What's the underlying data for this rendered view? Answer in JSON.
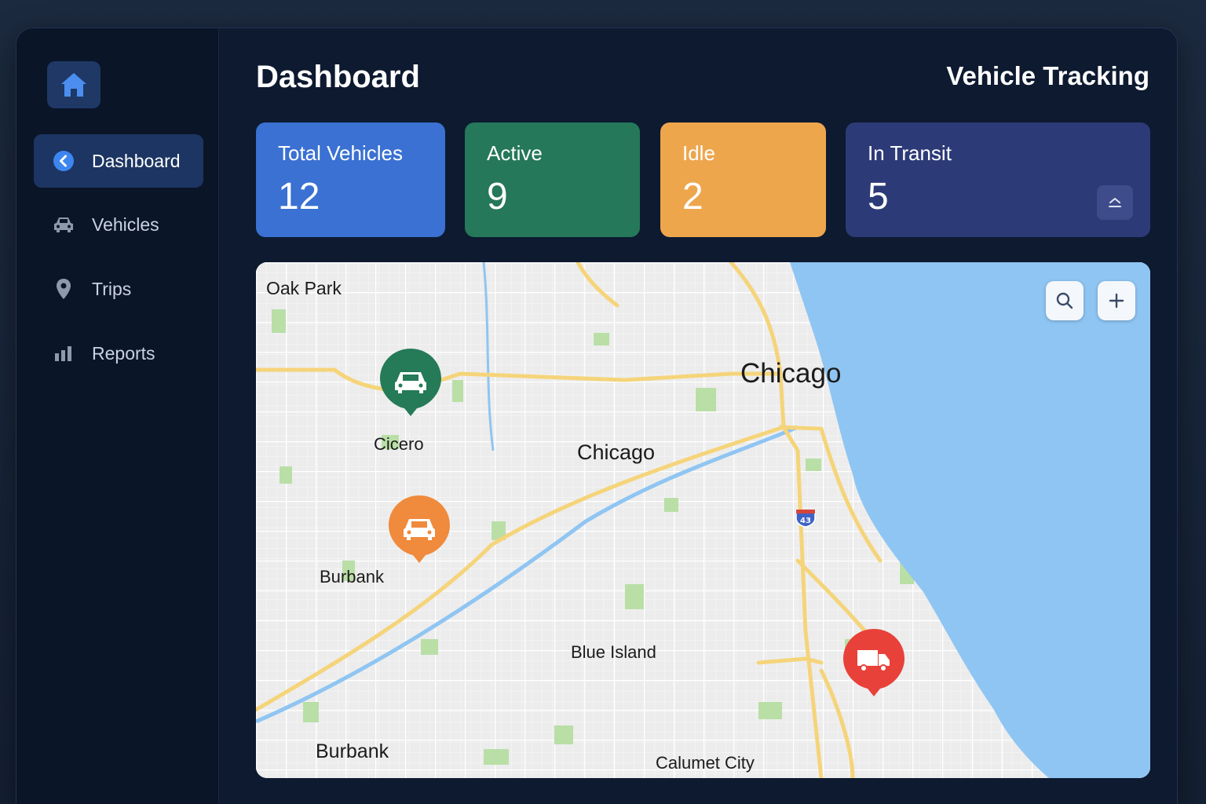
{
  "sidebar": {
    "items": [
      {
        "label": "Dashboard",
        "icon": "chevron-left-circle-icon",
        "active": true
      },
      {
        "label": "Vehicles",
        "icon": "car-icon"
      },
      {
        "label": "Trips",
        "icon": "location-pin-icon"
      },
      {
        "label": "Reports",
        "icon": "bar-chart-icon"
      }
    ]
  },
  "header": {
    "page_title": "Dashboard",
    "app_title": "Vehicle Tracking"
  },
  "stats": [
    {
      "label": "Total Vehicles",
      "value": "12",
      "color": "#3a71d2"
    },
    {
      "label": "Active",
      "value": "9",
      "color": "#25785a"
    },
    {
      "label": "Idle",
      "value": "2",
      "color": "#eea64d"
    },
    {
      "label": "In Transit",
      "value": "5",
      "color": "#2d3a78"
    }
  ],
  "map": {
    "labels": [
      "Oak Park",
      "Chicago",
      "Cicero",
      "Chicago",
      "Burbank",
      "Blue Island",
      "Burbank",
      "Calumet City"
    ],
    "highway_shield": "43",
    "markers": [
      {
        "icon": "car-icon",
        "color": "#257a58"
      },
      {
        "icon": "car-icon",
        "color": "#f08a3c"
      },
      {
        "icon": "truck-icon",
        "color": "#e8413a"
      }
    ],
    "colors": {
      "water": "#8fc5f2",
      "land": "#ececec",
      "highway": "#f5d47a",
      "park": "#b9dfa6"
    }
  }
}
